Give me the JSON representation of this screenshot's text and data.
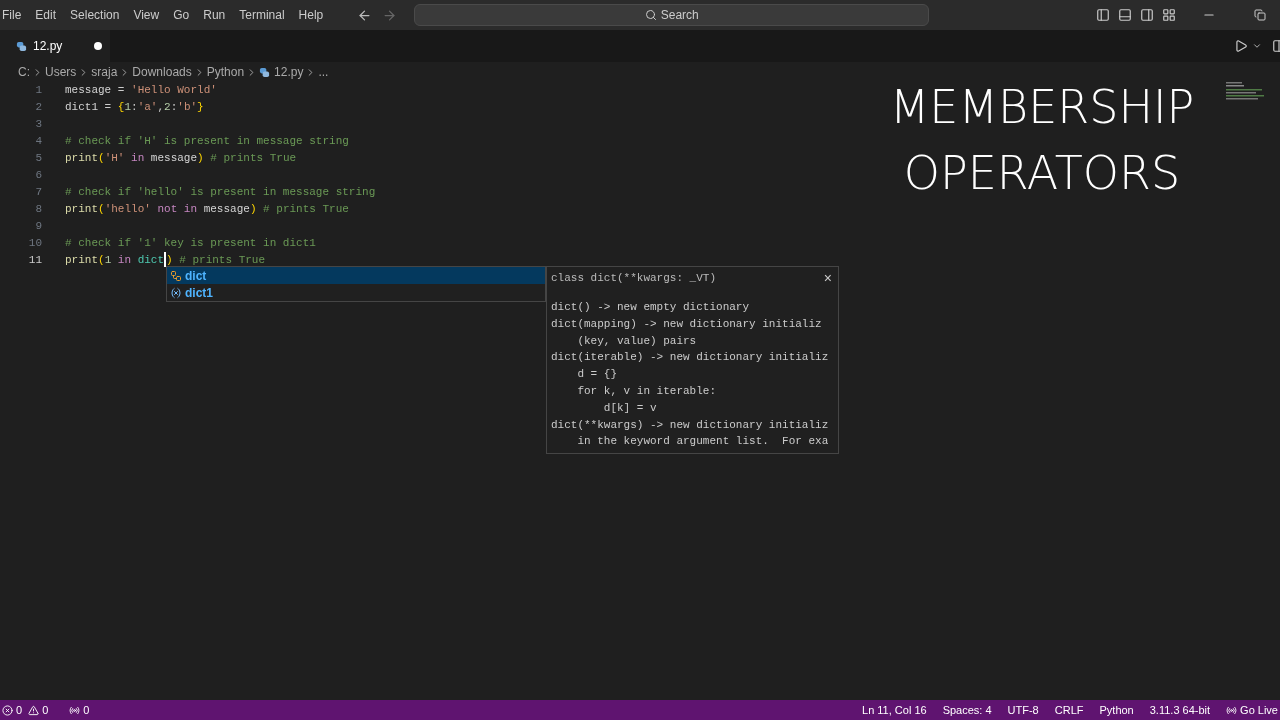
{
  "menu": [
    "File",
    "Edit",
    "Selection",
    "View",
    "Go",
    "Run",
    "Terminal",
    "Help"
  ],
  "search": {
    "placeholder": "Search"
  },
  "tab": {
    "label": "12.py",
    "modified": true
  },
  "breadcrumb": [
    "C:",
    "Users",
    "sraja",
    "Downloads",
    "Python",
    "12.py",
    "..."
  ],
  "lines": [
    {
      "number": "1",
      "current": false,
      "tokens": [
        {
          "t": "message",
          "kind": "var"
        },
        {
          "t": " = ",
          "kind": "op"
        },
        {
          "t": "'Hello World'",
          "kind": "str"
        }
      ]
    },
    {
      "number": "2",
      "current": false,
      "tokens": [
        {
          "t": "dict1",
          "kind": "var"
        },
        {
          "t": " = ",
          "kind": "op"
        },
        {
          "t": "{",
          "kind": "bracket"
        },
        {
          "t": "1",
          "kind": "num"
        },
        {
          "t": ":",
          "kind": "op"
        },
        {
          "t": "'a'",
          "kind": "str"
        },
        {
          "t": ",",
          "kind": "op"
        },
        {
          "t": "2",
          "kind": "num"
        },
        {
          "t": ":",
          "kind": "op"
        },
        {
          "t": "'b'",
          "kind": "str"
        },
        {
          "t": "}",
          "kind": "bracket"
        }
      ]
    },
    {
      "number": "3",
      "current": false
    },
    {
      "number": "4",
      "current": false,
      "tokens": [
        {
          "t": "# check if 'H' is present in message string",
          "kind": "comment"
        }
      ]
    },
    {
      "number": "5",
      "current": false,
      "tokens": [
        {
          "t": "print",
          "kind": "func"
        },
        {
          "t": "(",
          "kind": "bracket"
        },
        {
          "t": "'H'",
          "kind": "str"
        },
        {
          "t": " in ",
          "kind": "keyword"
        },
        {
          "t": "message",
          "kind": "var"
        },
        {
          "t": ")",
          "kind": "bracket"
        },
        {
          "t": " # prints True",
          "kind": "comment"
        }
      ]
    },
    {
      "number": "6",
      "current": false
    },
    {
      "number": "7",
      "current": false,
      "tokens": [
        {
          "t": "# check if 'hello' is present in message string",
          "kind": "comment"
        }
      ]
    },
    {
      "number": "8",
      "current": false,
      "tokens": [
        {
          "t": "print",
          "kind": "func"
        },
        {
          "t": "(",
          "kind": "bracket"
        },
        {
          "t": "'hello'",
          "kind": "str"
        },
        {
          "t": " not in ",
          "kind": "keyword"
        },
        {
          "t": "message",
          "kind": "var"
        },
        {
          "t": ")",
          "kind": "bracket"
        },
        {
          "t": " # prints True",
          "kind": "comment"
        }
      ]
    },
    {
      "number": "9",
      "current": false
    },
    {
      "number": "10",
      "current": false,
      "tokens": [
        {
          "t": "# check if '1' key is present in dict1",
          "kind": "comment"
        }
      ]
    },
    {
      "number": "11",
      "current": true,
      "tokens": [
        {
          "t": "print",
          "kind": "func"
        },
        {
          "t": "(",
          "kind": "bracket"
        },
        {
          "t": "1",
          "kind": "num"
        },
        {
          "t": " in ",
          "kind": "keyword"
        },
        {
          "t": "dict",
          "kind": "class",
          "cursor": true
        },
        {
          "t": ")",
          "kind": "bracket"
        },
        {
          "t": " # prints True",
          "kind": "comment"
        }
      ]
    }
  ],
  "suggestions": [
    {
      "label": "dict",
      "kind": "class",
      "selected": true
    },
    {
      "label": "dict1",
      "kind": "variable",
      "selected": false
    }
  ],
  "details": {
    "signature": "class dict(**kwargs: _VT)",
    "close": "×",
    "lines": [
      "dict() -> new empty dictionary",
      "dict(mapping) -> new dictionary initializ",
      "    (key, value) pairs",
      "dict(iterable) -> new dictionary initializ",
      "    d = {}",
      "    for k, v in iterable:",
      "        d[k] = v",
      "dict(**kwargs) -> new dictionary initializ",
      "    in the keyword argument list.  For exa"
    ]
  },
  "overlay_title": [
    "MEMBERSHIP",
    "OPERATORS"
  ],
  "status": {
    "errors": "0",
    "warnings": "0",
    "ports": "0",
    "items": [
      "Ln 11, Col 16",
      "Spaces: 4",
      "UTF-8",
      "CRLF",
      "Python",
      "3.11.3 64-bit"
    ],
    "live": "Go Live"
  }
}
